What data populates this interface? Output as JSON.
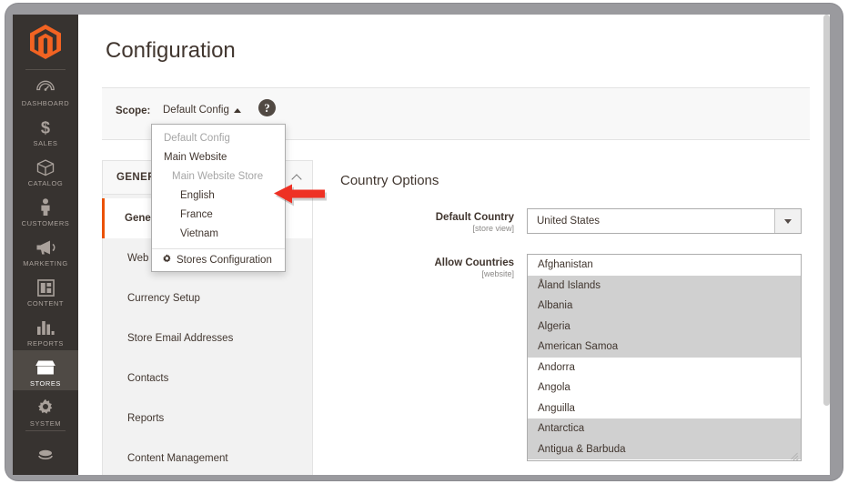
{
  "window": {
    "frame_color": "#9a9a9e"
  },
  "sidebar": {
    "logo_name": "magento-logo-icon",
    "items": [
      {
        "label": "DASHBOARD",
        "icon": "dashboard-icon",
        "active": false
      },
      {
        "label": "SALES",
        "icon": "dollar-icon",
        "active": false
      },
      {
        "label": "CATALOG",
        "icon": "box-icon",
        "active": false
      },
      {
        "label": "CUSTOMERS",
        "icon": "person-icon",
        "active": false
      },
      {
        "label": "MARKETING",
        "icon": "megaphone-icon",
        "active": false
      },
      {
        "label": "CONTENT",
        "icon": "layout-icon",
        "active": false
      },
      {
        "label": "REPORTS",
        "icon": "bar-chart-icon",
        "active": false
      },
      {
        "label": "STORES",
        "icon": "storefront-icon",
        "active": true
      },
      {
        "label": "SYSTEM",
        "icon": "gear-icon",
        "active": false
      }
    ],
    "partial_bottom_icon": "extensions-icon"
  },
  "header": {
    "title": "Configuration"
  },
  "scope": {
    "label": "Scope:",
    "current": "Default Config",
    "caret_icon": "caret-up-icon",
    "help_icon": "question-mark-icon",
    "help_glyph": "?"
  },
  "scope_dropdown": {
    "open": true,
    "items": [
      {
        "label": "Default Config",
        "type": "disabled"
      },
      {
        "label": "Main Website",
        "type": "website"
      },
      {
        "label": "Main Website Store",
        "type": "group"
      },
      {
        "label": "English",
        "type": "child"
      },
      {
        "label": "France",
        "type": "child"
      },
      {
        "label": "Vietnam",
        "type": "child"
      }
    ],
    "footer_label": "Stores Configuration",
    "footer_icon": "gear-icon"
  },
  "config_nav": {
    "section_title": "GENERAL",
    "collapse_icon": "chevron-up-icon",
    "items": [
      {
        "label": "General",
        "active": true
      },
      {
        "label": "Web",
        "active": false
      },
      {
        "label": "Currency Setup",
        "active": false
      },
      {
        "label": "Store Email Addresses",
        "active": false
      },
      {
        "label": "Contacts",
        "active": false
      },
      {
        "label": "Reports",
        "active": false
      },
      {
        "label": "Content Management",
        "active": false
      }
    ],
    "accent_color": "#eb5202"
  },
  "settings": {
    "title": "Country Options",
    "default_country": {
      "label": "Default Country",
      "scope": "[store view]",
      "value": "United States",
      "caret_icon": "caret-down-icon"
    },
    "allow_countries": {
      "label": "Allow Countries",
      "scope": "[website]",
      "options": [
        {
          "label": "Afghanistan",
          "selected": false
        },
        {
          "label": "Åland Islands",
          "selected": true
        },
        {
          "label": "Albania",
          "selected": true
        },
        {
          "label": "Algeria",
          "selected": true
        },
        {
          "label": "American Samoa",
          "selected": true
        },
        {
          "label": "Andorra",
          "selected": false
        },
        {
          "label": "Angola",
          "selected": false
        },
        {
          "label": "Anguilla",
          "selected": false
        },
        {
          "label": "Antarctica",
          "selected": true
        },
        {
          "label": "Antigua & Barbuda",
          "selected": true
        }
      ],
      "resize_handle_icon": "resize-grip-icon"
    }
  },
  "annotation": {
    "arrow_icon": "red-pointer-arrow-icon",
    "arrow_color": "#ee3124",
    "points_at": "English"
  },
  "scrollbar": {
    "name": "page-scrollbar",
    "thumb_color": "#cfcfcf"
  }
}
